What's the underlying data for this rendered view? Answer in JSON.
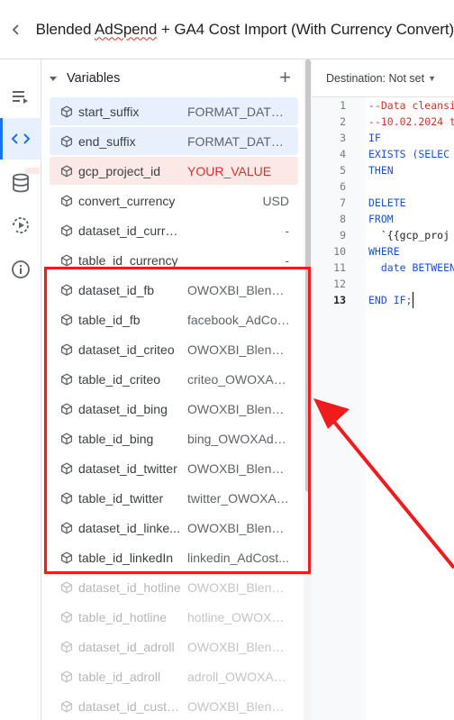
{
  "header": {
    "title_part1": "Blended ",
    "title_squig": "AdSpend",
    "title_part2": " + GA4 Cost Import (With Currency Convert)"
  },
  "rail": {
    "items": [
      "queue-list-icon",
      "code-icon",
      "database-icon",
      "history-play-icon",
      "info-icon"
    ],
    "active": "code-icon"
  },
  "variables": {
    "title": "Variables",
    "items": [
      {
        "name": "start_suffix",
        "value": "FORMAT_DATE('..."
      },
      {
        "name": "end_suffix",
        "value": "FORMAT_DATE('..."
      },
      {
        "name": "gcp_project_id",
        "value": "YOUR_VALUE"
      },
      {
        "name": "convert_currency",
        "value": "USD"
      },
      {
        "name": "dataset_id_curre...",
        "value": "-"
      },
      {
        "name": "table_id_currency",
        "value": "-"
      },
      {
        "name": "dataset_id_fb",
        "value": "OWOXBI_Blende..."
      },
      {
        "name": "table_id_fb",
        "value": "facebook_AdCos..."
      },
      {
        "name": "dataset_id_criteo",
        "value": "OWOXBI_Blende..."
      },
      {
        "name": "table_id_criteo",
        "value": "criteo_OWOXAd..."
      },
      {
        "name": "dataset_id_bing",
        "value": "OWOXBI_Blende..."
      },
      {
        "name": "table_id_bing",
        "value": "bing_OWOXAdC..."
      },
      {
        "name": "dataset_id_twitter",
        "value": "OWOXBI_Blende..."
      },
      {
        "name": "table_id_twitter",
        "value": "twitter_OWOXAd..."
      },
      {
        "name": "dataset_id_linke...",
        "value": "OWOXBI_Blende..."
      },
      {
        "name": "table_id_linkedIn",
        "value": "linkedin_AdCost..."
      },
      {
        "name": "dataset_id_hotline",
        "value": "OWOXBI_Blende..."
      },
      {
        "name": "table_id_hotline",
        "value": "hotline_OWOXAd..."
      },
      {
        "name": "dataset_id_adroll",
        "value": "OWOXBI_Blende..."
      },
      {
        "name": "table_id_adroll",
        "value": "adroll_OWOXAd..."
      },
      {
        "name": "dataset_id_custo...",
        "value": "OWOXBI_Blende..."
      }
    ]
  },
  "editor": {
    "destination": "Destination: Not set",
    "lines": [
      {
        "n": "1",
        "t": "--Data cleansi",
        "c": "cmt"
      },
      {
        "n": "2",
        "t": "--10.02.2024 t",
        "c": "cmt"
      },
      {
        "n": "3",
        "t": "IF",
        "c": "kw"
      },
      {
        "n": "4",
        "t": "EXISTS (SELEC",
        "c": "kw"
      },
      {
        "n": "5",
        "t": "THEN",
        "c": "kw"
      },
      {
        "n": "6",
        "t": "",
        "c": "plain"
      },
      {
        "n": "7",
        "t": "DELETE",
        "c": "kw"
      },
      {
        "n": "8",
        "t": "FROM",
        "c": "kw"
      },
      {
        "n": "9",
        "t": "  `{{gcp_proj",
        "c": "plain"
      },
      {
        "n": "10",
        "t": "WHERE",
        "c": "kw"
      },
      {
        "n": "11",
        "t": "  date BETWEEN",
        "c": "kw"
      },
      {
        "n": "12",
        "t": "",
        "c": "plain"
      },
      {
        "n": "13",
        "t": "END IF;",
        "c": "kw"
      }
    ]
  },
  "colors": {
    "accent": "#1a73e8",
    "highlight": "#ee1c1c",
    "variable_selected": "#e8f0fe",
    "variable_error": "#fce8e6"
  }
}
